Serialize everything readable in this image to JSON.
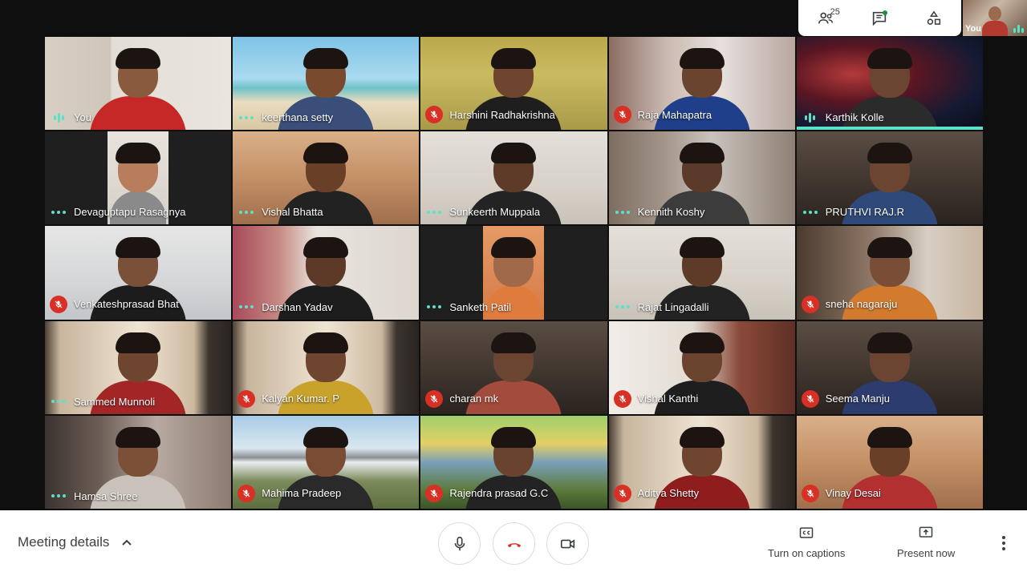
{
  "toolbar": {
    "people_count": "25",
    "icons": [
      "people-icon",
      "chat-icon",
      "activities-icon"
    ]
  },
  "self_preview": {
    "label": "You"
  },
  "participants": [
    {
      "name": "You",
      "status": "talking",
      "scene": "room-white"
    },
    {
      "name": "keerthana setty",
      "status": "idle",
      "scene": "beach"
    },
    {
      "name": "Harshini Radhakrishna",
      "status": "muted",
      "scene": "room-yellow"
    },
    {
      "name": "Raja Mahapatra",
      "status": "muted",
      "scene": "room-poster"
    },
    {
      "name": "Karthik Kolle",
      "status": "talking",
      "scene": "nebula",
      "active": true
    },
    {
      "name": "Devaguptapu Rasagnya",
      "status": "idle",
      "scene": "narrow"
    },
    {
      "name": "Vishal Bhatta",
      "status": "idle",
      "scene": "room-warm"
    },
    {
      "name": "Sunkeerth Muppala",
      "status": "idle",
      "scene": "room-plain"
    },
    {
      "name": "Kennith Koshy",
      "status": "idle",
      "scene": "room-curtain"
    },
    {
      "name": "PRUTHVI RAJ.R",
      "status": "idle",
      "scene": "room-dark"
    },
    {
      "name": "Venkateshprasad Bhat",
      "status": "muted",
      "scene": "room-grey"
    },
    {
      "name": "Darshan Yadav",
      "status": "idle",
      "scene": "room-pattern"
    },
    {
      "name": "Sanketh Patil",
      "status": "idle",
      "scene": "narrow-orange"
    },
    {
      "name": "Rajat Lingadalli",
      "status": "idle",
      "scene": "room-plain"
    },
    {
      "name": "sneha nagaraju",
      "status": "muted",
      "scene": "room-shelf"
    },
    {
      "name": "Sammed Munnoli",
      "status": "idle",
      "scene": "tv"
    },
    {
      "name": "Kalyan Kumar. P",
      "status": "muted",
      "scene": "tv"
    },
    {
      "name": "charan mk",
      "status": "muted",
      "scene": "room-dark"
    },
    {
      "name": "Vishal Kanthi",
      "status": "muted",
      "scene": "room-wood"
    },
    {
      "name": "Seema Manju",
      "status": "muted",
      "scene": "room-dark"
    },
    {
      "name": "Hamsa Shree",
      "status": "idle",
      "scene": "room-cloth"
    },
    {
      "name": "Mahima Pradeep",
      "status": "muted",
      "scene": "mountains"
    },
    {
      "name": "Rajendra prasad G.C",
      "status": "muted",
      "scene": "forest"
    },
    {
      "name": "Aditya Shetty",
      "status": "muted",
      "scene": "tv"
    },
    {
      "name": "Vinay Desai",
      "status": "muted",
      "scene": "room-warm"
    }
  ],
  "bottom_bar": {
    "meeting_details_label": "Meeting details",
    "captions_label": "Turn on captions",
    "present_label": "Present now"
  },
  "colors": {
    "mute_red": "#d93025",
    "activity_teal": "#5ce1c9",
    "end_call_red": "#d93025"
  }
}
